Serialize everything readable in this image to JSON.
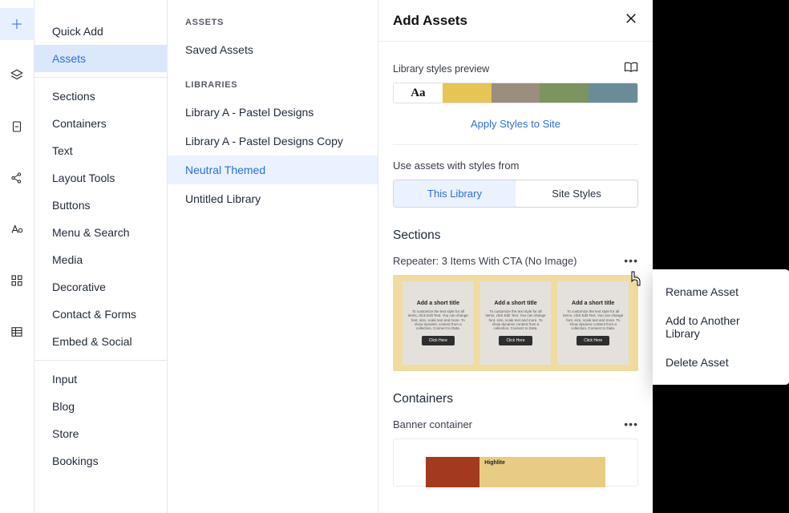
{
  "iconrail": [
    "plus",
    "layers",
    "document",
    "share",
    "typography",
    "blocks",
    "table"
  ],
  "sidebar": {
    "top": [
      "Quick Add",
      "Assets"
    ],
    "active_top": "Assets",
    "groups": [
      [
        "Sections",
        "Containers",
        "Text",
        "Layout Tools",
        "Buttons",
        "Menu & Search",
        "Media",
        "Decorative",
        "Contact & Forms",
        "Embed & Social"
      ],
      [
        "Input",
        "Blog",
        "Store",
        "Bookings"
      ]
    ]
  },
  "libs": {
    "assets_heading": "ASSETS",
    "saved": "Saved Assets",
    "libraries_heading": "LIBRARIES",
    "items": [
      "Library A - Pastel Designs",
      "Library A - Pastel Designs Copy",
      "Neutral Themed",
      "Untitled Library"
    ],
    "active": "Neutral Themed"
  },
  "panel": {
    "title": "Add Assets",
    "preview_label": "Library styles preview",
    "aa": "Aa",
    "swatches": [
      "#e7c456",
      "#9b8e7e",
      "#7d9360",
      "#6a8c98"
    ],
    "apply": "Apply Styles to Site",
    "use_from": "Use assets with styles from",
    "seg": {
      "a": "This Library",
      "b": "Site Styles"
    },
    "sections_heading": "Sections",
    "asset1_name": "Repeater: 3 Items With CTA (No Image)",
    "card_title": "Add a short title",
    "card_body": "To customize the text style for all items, click Edit Text. You can change font, size, scale text and more. To show dynamic content from a collection, Connect to Data.",
    "card_btn": "Click Here",
    "containers_heading": "Containers",
    "asset2_name": "Banner container",
    "banner_brand": "Highlite"
  },
  "ctx": {
    "rename": "Rename Asset",
    "add": "Add to Another Library",
    "del": "Delete Asset"
  }
}
